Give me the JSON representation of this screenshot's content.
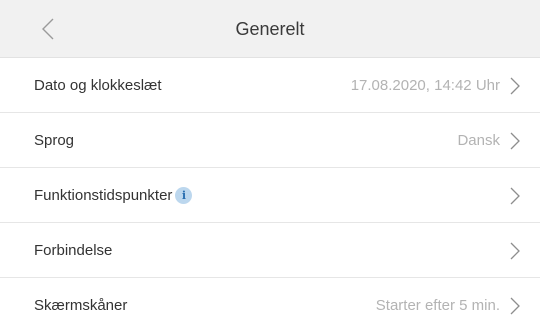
{
  "header": {
    "title": "Generelt",
    "back_icon": "chevron-left-icon"
  },
  "rows": [
    {
      "label": "Dato og klokkeslæt",
      "value": "17.08.2020, 14:42 Uhr"
    },
    {
      "label": "Sprog",
      "value": "Dansk"
    },
    {
      "label": "Funktionstidspunkter",
      "value": "",
      "info_icon": "i"
    },
    {
      "label": "Forbindelse",
      "value": ""
    },
    {
      "label": "Skærmskåner",
      "value": "Starter efter 5 min."
    }
  ],
  "colors": {
    "header_bg": "#f1f1f1",
    "info_accent": "#2a6fb0"
  }
}
